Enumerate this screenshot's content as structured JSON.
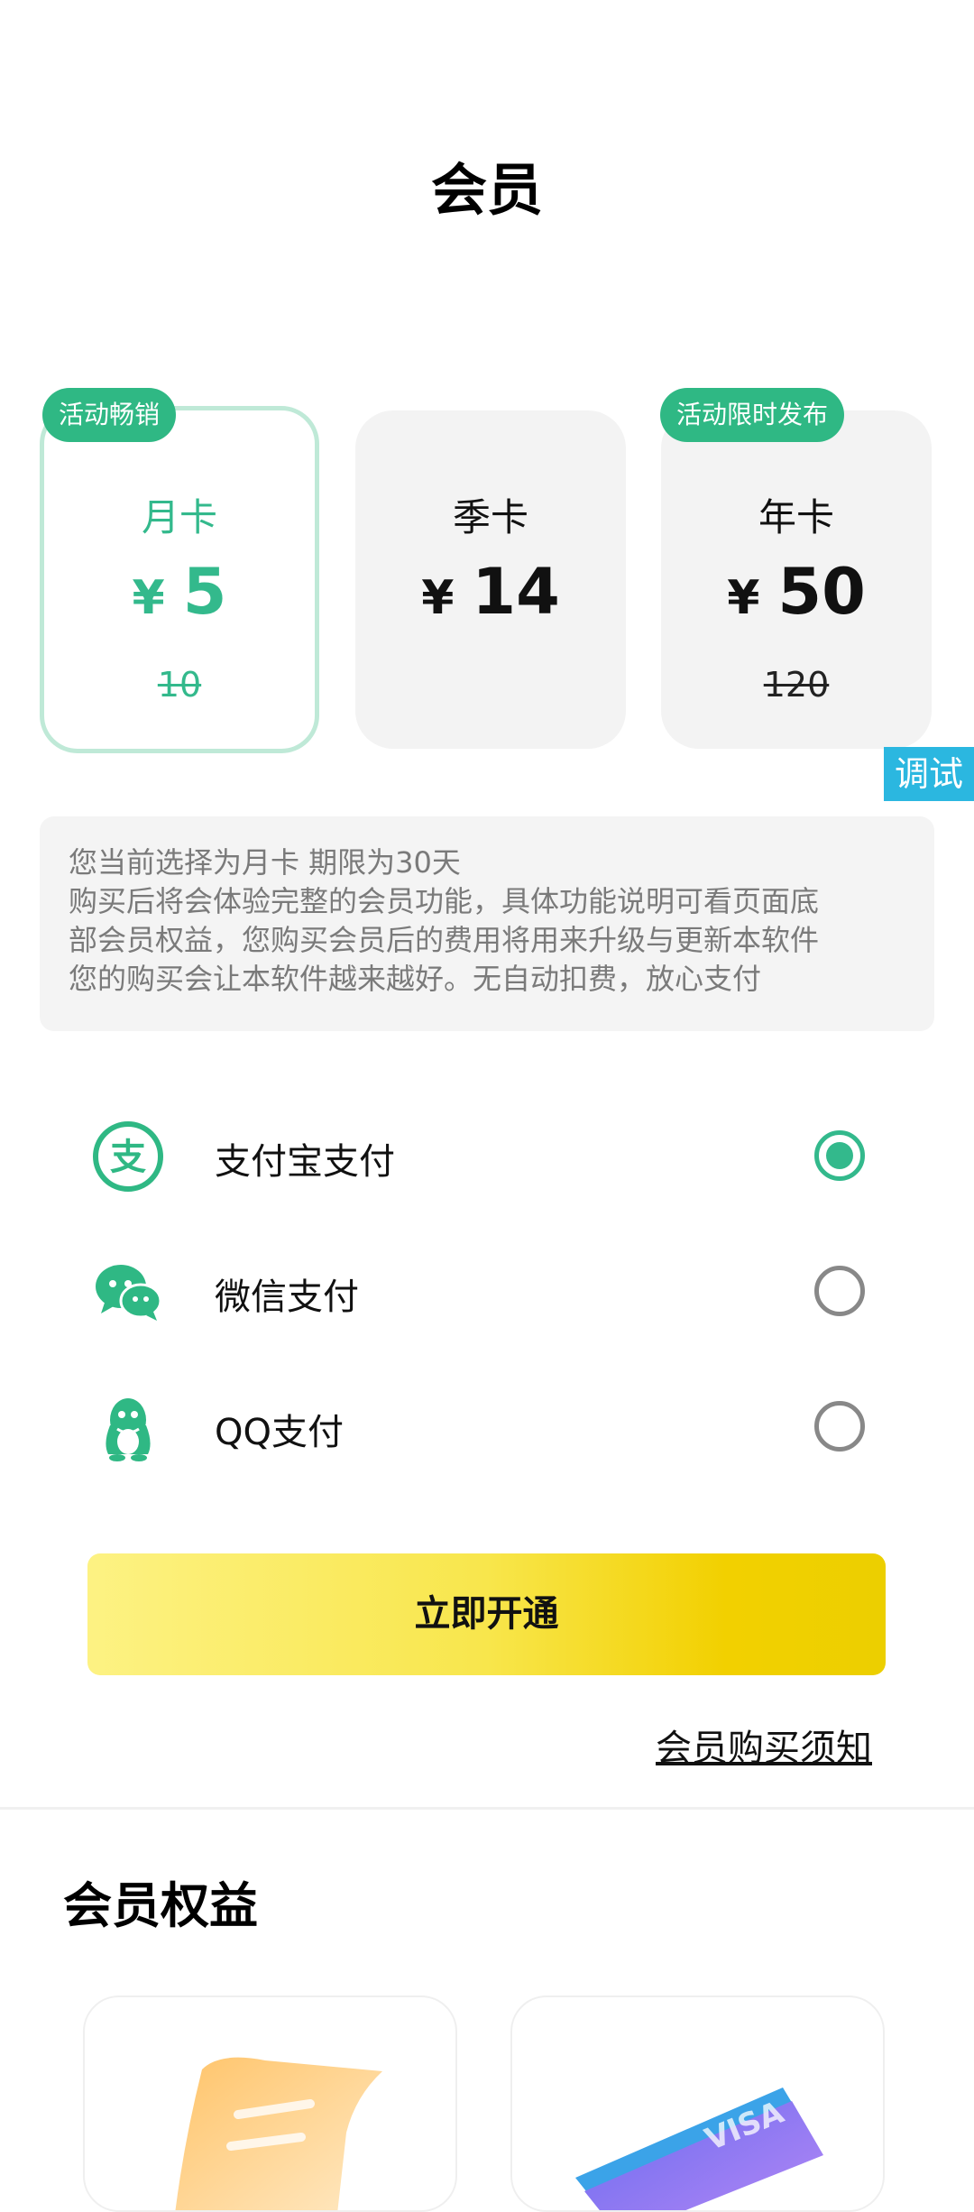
{
  "header": {
    "title": "会员"
  },
  "plans": [
    {
      "name": "月卡",
      "currency": "¥",
      "price": "5",
      "original": "10",
      "badge": "活动畅销",
      "selected": true
    },
    {
      "name": "季卡",
      "currency": "¥",
      "price": "14",
      "original": "",
      "badge": "",
      "selected": false
    },
    {
      "name": "年卡",
      "currency": "¥",
      "price": "50",
      "original": "120",
      "badge": "活动限时发布",
      "selected": false
    }
  ],
  "debug_label": "调试",
  "description": {
    "lines": [
      "您当前选择为月卡 期限为30天",
      "购买后将会体验完整的会员功能，具体功能说明可看页面底",
      "部会员权益，您购买会员后的费用将用来升级与更新本软件",
      "您的购买会让本软件越来越好。无自动扣费，放心支付"
    ]
  },
  "payment": {
    "options": [
      {
        "label": "支付宝支付",
        "icon": "alipay-icon",
        "checked": true
      },
      {
        "label": "微信支付",
        "icon": "wechat-icon",
        "checked": false
      },
      {
        "label": "QQ支付",
        "icon": "qq-icon",
        "checked": false
      }
    ]
  },
  "cta": {
    "label": "立即开通"
  },
  "notice_link": "会员购买须知",
  "benefits": {
    "title": "会员权益"
  },
  "colors": {
    "accent": "#33b98c",
    "badge": "#2fb884",
    "cta_start": "#fdf283",
    "cta_end": "#eccf00",
    "debug": "#2bb7e0"
  }
}
